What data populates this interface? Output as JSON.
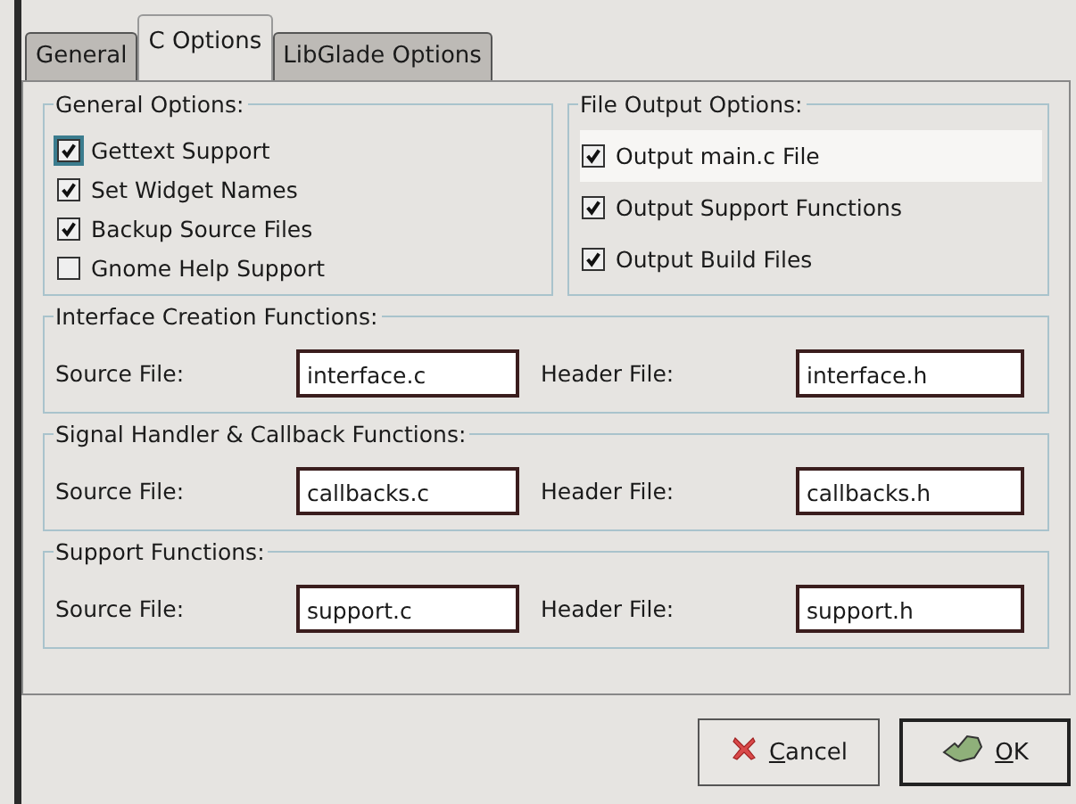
{
  "tabs": [
    {
      "label": "General",
      "selected": false
    },
    {
      "label": "C Options",
      "selected": true
    },
    {
      "label": "LibGlade Options",
      "selected": false
    }
  ],
  "general_options": {
    "title": "General Options:",
    "items": [
      {
        "label": "Gettext Support",
        "checked": true,
        "focused": true,
        "hovered": false
      },
      {
        "label": "Set Widget Names",
        "checked": true,
        "hovered": false
      },
      {
        "label": "Backup Source Files",
        "checked": true,
        "hovered": false
      },
      {
        "label": "Gnome Help Support",
        "checked": false,
        "hovered": false
      }
    ]
  },
  "file_output_options": {
    "title": "File Output Options:",
    "items": [
      {
        "label": "Output main.c File",
        "checked": true,
        "hovered": true
      },
      {
        "label": "Output Support Functions",
        "checked": true,
        "hovered": false
      },
      {
        "label": "Output Build Files",
        "checked": true,
        "hovered": false
      }
    ]
  },
  "file_groups": [
    {
      "title": "Interface Creation Functions:",
      "source_label": "Source File:",
      "source_value": "interface.c",
      "header_label": "Header File:",
      "header_value": "interface.h"
    },
    {
      "title": "Signal Handler & Callback Functions:",
      "source_label": "Source File:",
      "source_value": "callbacks.c",
      "header_label": "Header File:",
      "header_value": "callbacks.h"
    },
    {
      "title": "Support Functions:",
      "source_label": "Source File:",
      "source_value": "support.c",
      "header_label": "Header File:",
      "header_value": "support.h"
    }
  ],
  "buttons": [
    {
      "kind": "cancel",
      "label": "Cancel"
    },
    {
      "kind": "ok",
      "label": "OK"
    }
  ]
}
